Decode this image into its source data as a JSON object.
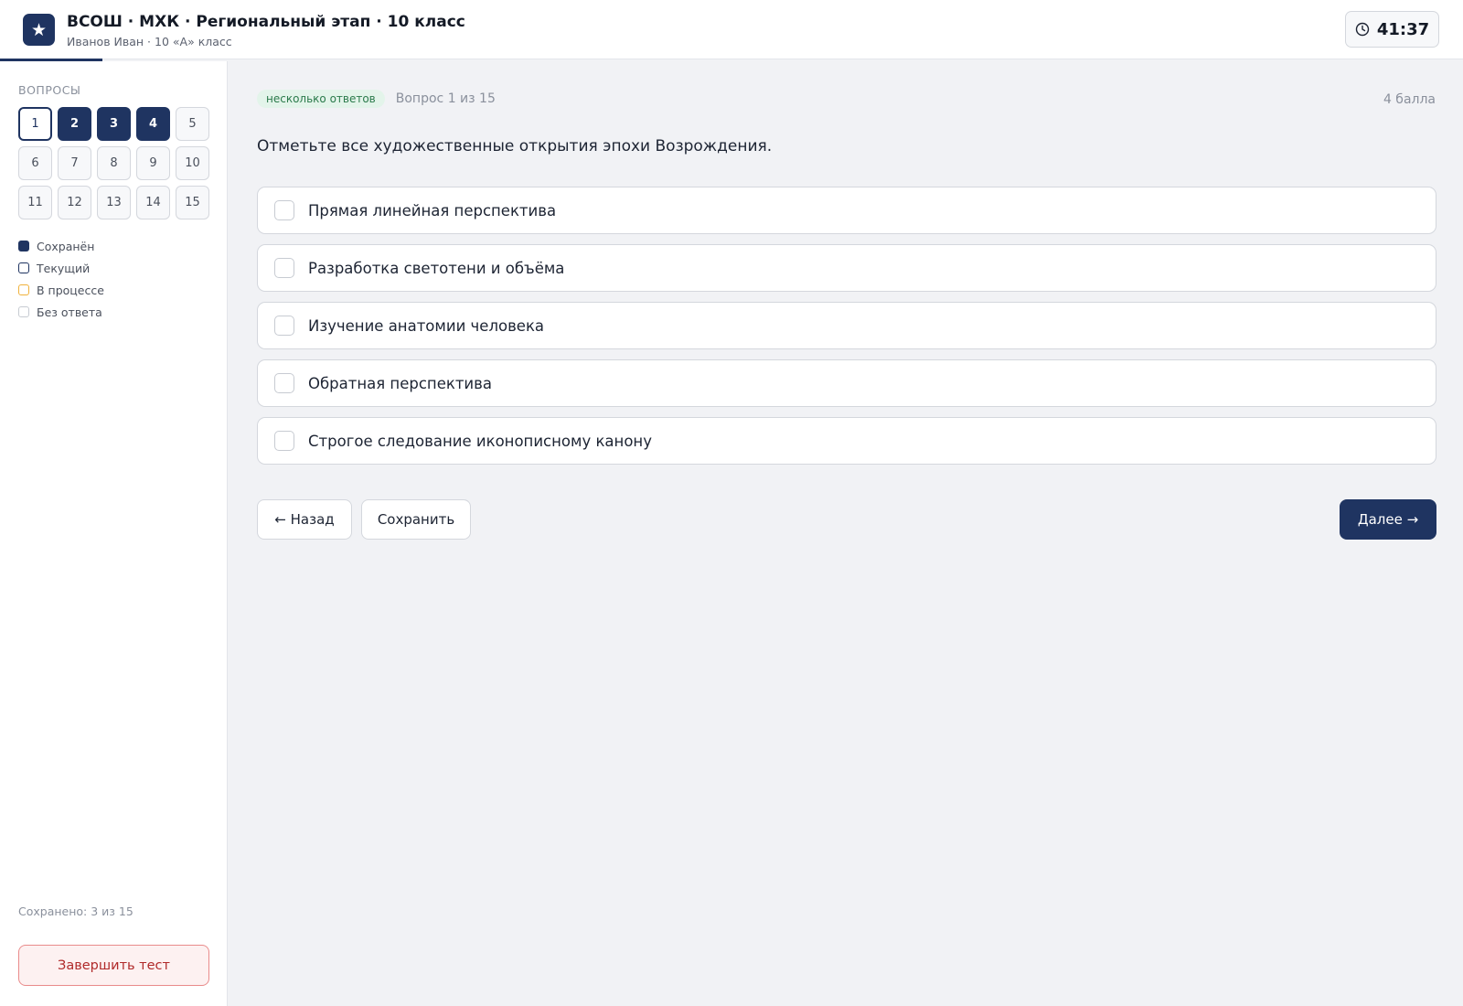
{
  "header": {
    "logo_glyph": "★",
    "title": "ВСОШ · МХК · Региональный этап · 10 класс",
    "subtitle": "Иванов Иван · 10 «А» класс",
    "timer_icon": "clock-icon",
    "timer": "41:37"
  },
  "sidebar": {
    "title": "ВОПРОСЫ",
    "questions": [
      {
        "label": "1",
        "state": "current"
      },
      {
        "label": "2",
        "state": "saved"
      },
      {
        "label": "3",
        "state": "saved"
      },
      {
        "label": "4",
        "state": "saved"
      },
      {
        "label": "5",
        "state": "empty"
      },
      {
        "label": "6",
        "state": "empty"
      },
      {
        "label": "7",
        "state": "empty"
      },
      {
        "label": "8",
        "state": "empty"
      },
      {
        "label": "9",
        "state": "empty"
      },
      {
        "label": "10",
        "state": "empty"
      },
      {
        "label": "11",
        "state": "empty"
      },
      {
        "label": "12",
        "state": "empty"
      },
      {
        "label": "13",
        "state": "empty"
      },
      {
        "label": "14",
        "state": "empty"
      },
      {
        "label": "15",
        "state": "empty"
      }
    ],
    "legend": [
      {
        "label": "Сохранён",
        "state": "saved"
      },
      {
        "label": "Текущий",
        "state": "current"
      },
      {
        "label": "В процессе",
        "state": "progress"
      },
      {
        "label": "Без ответа",
        "state": "empty"
      }
    ],
    "saved_count": "Сохранено: 3 из 15",
    "finish_label": "Завершить тест"
  },
  "main": {
    "badge": "несколько ответов",
    "counter": "Вопрос 1 из 15",
    "points": "4 балла",
    "question": "Отметьте все художественные открытия эпохи Возрождения.",
    "options": [
      {
        "label": "Прямая линейная перспектива",
        "checked": false
      },
      {
        "label": "Разработка светотени и объёма",
        "checked": false
      },
      {
        "label": "Изучение анатомии человека",
        "checked": false
      },
      {
        "label": "Обратная перспектива",
        "checked": false
      },
      {
        "label": "Строгое следование иконописному канону",
        "checked": false
      }
    ],
    "back_label": "← Назад",
    "save_label": "Сохранить",
    "next_label": "Далее →"
  },
  "colors": {
    "accent": "#1f3461",
    "badge_bg": "#e3f4ea",
    "badge_text": "#2b7a4b",
    "in_progress": "#f0b23c",
    "danger": "#b02a2a"
  }
}
